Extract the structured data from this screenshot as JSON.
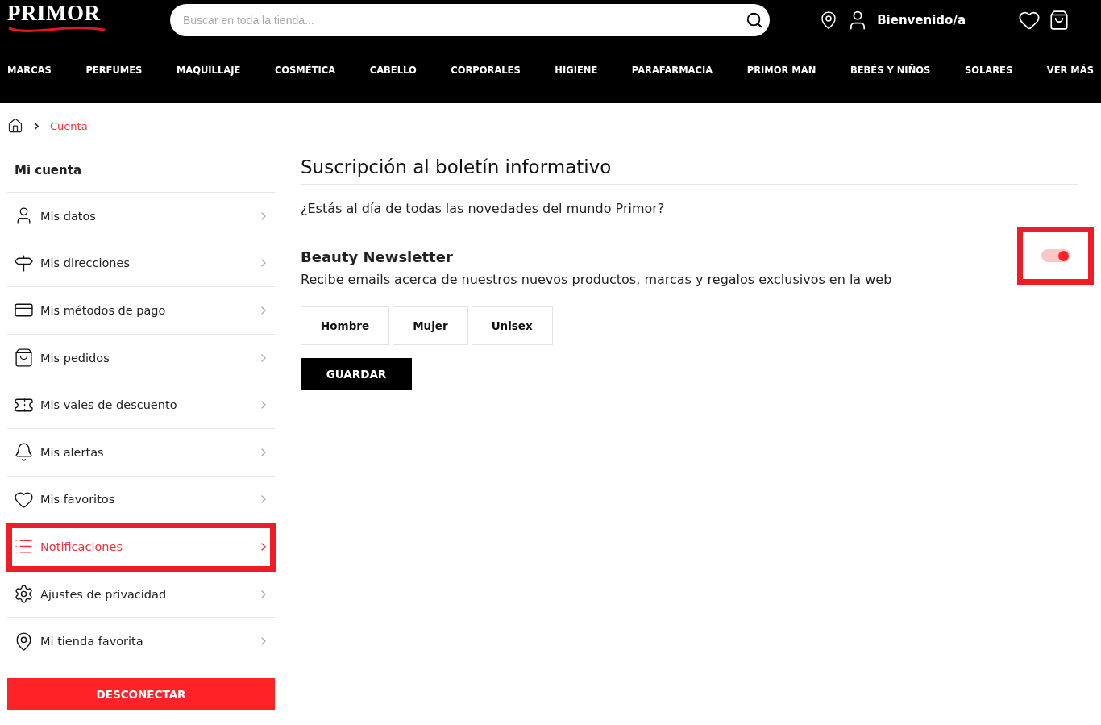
{
  "header": {
    "logo": "PRIMOR",
    "search": {
      "placeholder": "Buscar en toda la tienda..."
    },
    "greeting": "Bienvenido/a"
  },
  "nav": [
    "MARCAS",
    "PERFUMES",
    "MAQUILLAJE",
    "COSMÉTICA",
    "CABELLO",
    "CORPORALES",
    "HIGIENE",
    "PARAFARMACIA",
    "PRIMOR MAN",
    "BEBÉS Y NIÑOS",
    "SOLARES",
    "VER MÁS"
  ],
  "breadcrumb": [
    "Cuenta"
  ],
  "sidebar": {
    "title": "Mi cuenta",
    "items": [
      {
        "kind": "user",
        "label": "Mis datos",
        "selected": false,
        "highlighted": false
      },
      {
        "kind": "signpost",
        "label": "Mis direcciones",
        "selected": false,
        "highlighted": false
      },
      {
        "kind": "card",
        "label": "Mis métodos de pago",
        "selected": false,
        "highlighted": false
      },
      {
        "kind": "bag",
        "label": "Mis pedidos",
        "selected": false,
        "highlighted": false
      },
      {
        "kind": "voucher",
        "label": "Mis vales de descuento",
        "selected": false,
        "highlighted": false
      },
      {
        "kind": "bell",
        "label": "Mis alertas",
        "selected": false,
        "highlighted": false
      },
      {
        "kind": "heart",
        "label": "Mis favoritos",
        "selected": false,
        "highlighted": false
      },
      {
        "kind": "list",
        "label": "Notificaciones",
        "selected": true,
        "highlighted": true
      },
      {
        "kind": "gear",
        "label": "Ajustes de privacidad",
        "selected": false,
        "highlighted": false
      },
      {
        "kind": "pin",
        "label": "Mi tienda favorita",
        "selected": false,
        "highlighted": false
      }
    ],
    "logout": "DESCONECTAR"
  },
  "main": {
    "title": "Suscripción al boletín informativo",
    "intro": "¿Estás al día de todas las novedades del mundo Primor?",
    "newsletter": {
      "name": "Beauty Newsletter",
      "description": "Recibe emails acerca de nuestros nuevos productos, marcas y regalos exclusivos en la web",
      "on": true,
      "highlighted": true
    },
    "options": [
      {
        "label": "Hombre",
        "selected": false
      },
      {
        "label": "Mujer",
        "selected": false
      },
      {
        "label": "Unisex",
        "selected": false
      }
    ],
    "save": "GUARDAR"
  }
}
